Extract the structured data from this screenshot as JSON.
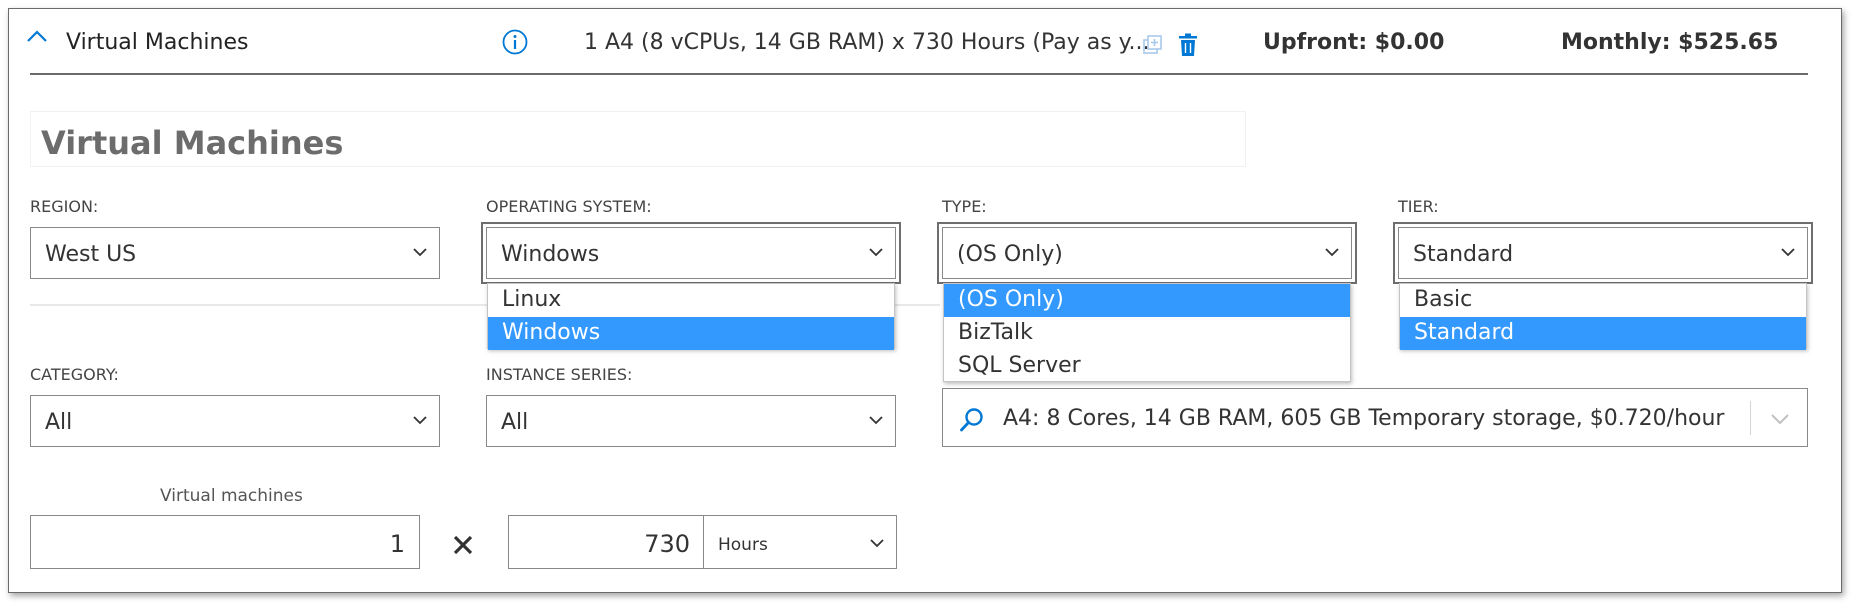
{
  "header": {
    "title": "Virtual Machines",
    "summary": "1 A4 (8 vCPUs, 14 GB RAM) x 730 Hours (Pay as y...",
    "upfront": "Upfront: $0.00",
    "monthly": "Monthly: $525.65",
    "icons": [
      "chevron-up-icon",
      "info-icon",
      "clone-icon",
      "delete-icon"
    ]
  },
  "form": {
    "name": "Virtual Machines",
    "region": {
      "label": "REGION:",
      "value": "West US"
    },
    "os": {
      "label": "OPERATING SYSTEM:",
      "value": "Windows",
      "options": [
        "Linux",
        "Windows"
      ],
      "selected": "Windows"
    },
    "type": {
      "label": "TYPE:",
      "value": "(OS Only)",
      "options": [
        "(OS Only)",
        "BizTalk",
        "SQL Server"
      ],
      "selected": "(OS Only)"
    },
    "tier": {
      "label": "TIER:",
      "value": "Standard",
      "options": [
        "Basic",
        "Standard"
      ],
      "selected": "Standard"
    },
    "category": {
      "label": "CATEGORY:",
      "value": "All"
    },
    "instance_series": {
      "label": "INSTANCE SERIES:",
      "value": "All"
    },
    "instance": {
      "value": "A4: 8 Cores, 14 GB RAM, 605 GB Temporary storage, $0.720/hour"
    },
    "vm_count": {
      "label": "Virtual machines",
      "value": "1"
    },
    "hours": {
      "value": "730",
      "unit": "Hours"
    }
  },
  "colors": {
    "accent": "#0078d4",
    "selection": "#3399ff",
    "border": "#898989"
  }
}
